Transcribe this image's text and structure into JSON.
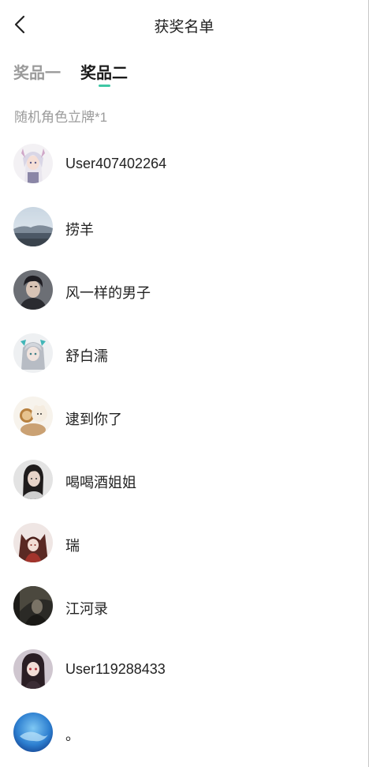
{
  "header": {
    "title": "获奖名单",
    "back_icon": "chevron-left-icon"
  },
  "tabs": [
    {
      "label": "奖品一",
      "active": false
    },
    {
      "label": "奖品二",
      "active": true
    }
  ],
  "accent_color": "#3fc7a4",
  "prize": {
    "name": "随机角色立牌*1"
  },
  "winners": [
    {
      "name": "User407402264",
      "avatar": "anime-girl-white-hair-avatar"
    },
    {
      "name": "捞羊",
      "avatar": "landscape-sea-avatar"
    },
    {
      "name": "风一样的男子",
      "avatar": "dark-hair-boy-avatar"
    },
    {
      "name": "舒白濡",
      "avatar": "silver-hair-girl-avatar"
    },
    {
      "name": "逮到你了",
      "avatar": "cartoon-animals-avatar"
    },
    {
      "name": "喝喝酒姐姐",
      "avatar": "realistic-woman-avatar"
    },
    {
      "name": "瑞",
      "avatar": "fox-girl-avatar"
    },
    {
      "name": "江河录",
      "avatar": "dark-figure-avatar"
    },
    {
      "name": "User119288433",
      "avatar": "anime-girl-dark-hair-avatar"
    },
    {
      "name": "。",
      "avatar": "blue-ocean-avatar"
    }
  ]
}
